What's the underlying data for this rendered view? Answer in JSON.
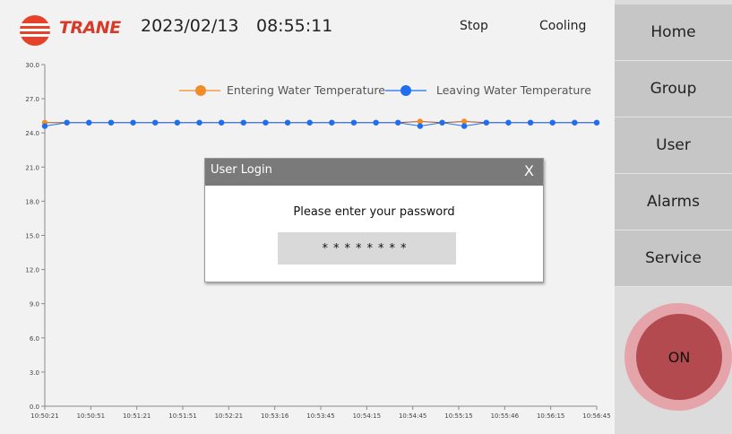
{
  "header": {
    "brand": "TRANE",
    "date": "2023/02/13",
    "time": "08:55:11",
    "status_run": "Stop",
    "status_mode": "Cooling"
  },
  "sidebar": {
    "items": [
      {
        "label": "Home"
      },
      {
        "label": "Group"
      },
      {
        "label": "User"
      },
      {
        "label": "Alarms"
      },
      {
        "label": "Service"
      }
    ],
    "on_label": "ON"
  },
  "chart_data": {
    "type": "line",
    "categories": [
      "10:50:21",
      "10:50:51",
      "10:51:21",
      "10:51:51",
      "10:52:21",
      "10:53:16",
      "10:53:45",
      "10:54:15",
      "10:54:45",
      "10:55:15",
      "10:55:46",
      "10:56:15",
      "10:56:45"
    ],
    "y_ticks": [
      "0.0",
      "3.0",
      "6.0",
      "9.0",
      "12.0",
      "15.0",
      "18.0",
      "21.0",
      "24.0",
      "27.0",
      "30.0"
    ],
    "ylim": [
      0,
      30
    ],
    "legend_position": "top-right",
    "series": [
      {
        "name": "Entering Water Temperature",
        "color": "#f28c28",
        "values": [
          24.9,
          24.9,
          24.9,
          24.9,
          24.9,
          24.9,
          24.9,
          24.9,
          24.9,
          24.9,
          24.9,
          24.9,
          24.9,
          24.9,
          24.9,
          24.9,
          24.9,
          25.0,
          24.9,
          25.0,
          24.9,
          24.9,
          24.9,
          24.9,
          24.9,
          24.9
        ]
      },
      {
        "name": "Leaving Water Temperature",
        "color": "#1e6ff0",
        "values": [
          24.6,
          24.9,
          24.9,
          24.9,
          24.9,
          24.9,
          24.9,
          24.9,
          24.9,
          24.9,
          24.9,
          24.9,
          24.9,
          24.9,
          24.9,
          24.9,
          24.9,
          24.6,
          24.9,
          24.6,
          24.9,
          24.9,
          24.9,
          24.9,
          24.9,
          24.9
        ]
      }
    ]
  },
  "login": {
    "title": "User Login",
    "close": "X",
    "prompt": "Please enter your password",
    "password_mask": "********"
  }
}
